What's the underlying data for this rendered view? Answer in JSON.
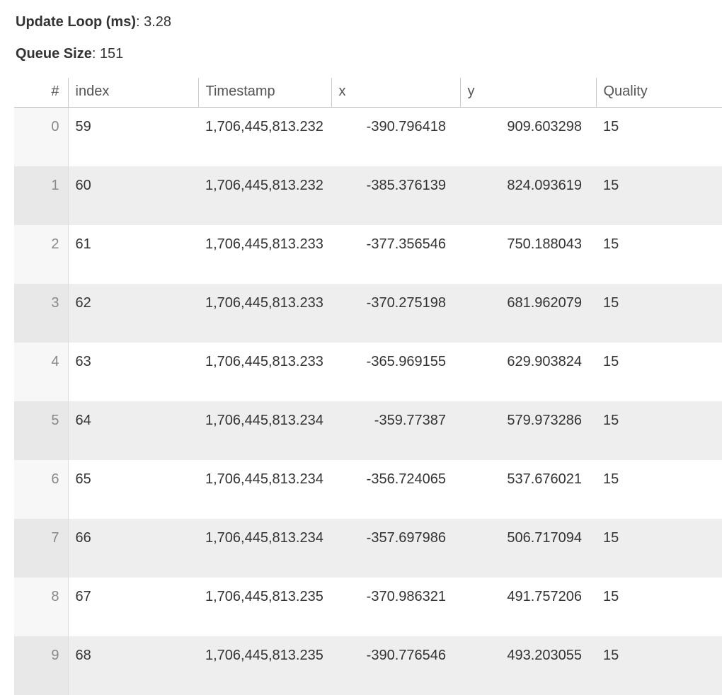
{
  "stats": {
    "update_loop_label": "Update Loop (ms)",
    "update_loop_value": "3.28",
    "queue_size_label": "Queue Size",
    "queue_size_value": "151"
  },
  "table": {
    "headers": {
      "rownum": "#",
      "index": "index",
      "timestamp": "Timestamp",
      "x": "x",
      "y": "y",
      "quality": "Quality"
    },
    "rows": [
      {
        "rownum": "0",
        "index": "59",
        "timestamp": "1,706,445,813.232",
        "x": "-390.796418",
        "y": "909.603298",
        "quality": "15"
      },
      {
        "rownum": "1",
        "index": "60",
        "timestamp": "1,706,445,813.232",
        "x": "-385.376139",
        "y": "824.093619",
        "quality": "15"
      },
      {
        "rownum": "2",
        "index": "61",
        "timestamp": "1,706,445,813.233",
        "x": "-377.356546",
        "y": "750.188043",
        "quality": "15"
      },
      {
        "rownum": "3",
        "index": "62",
        "timestamp": "1,706,445,813.233",
        "x": "-370.275198",
        "y": "681.962079",
        "quality": "15"
      },
      {
        "rownum": "4",
        "index": "63",
        "timestamp": "1,706,445,813.233",
        "x": "-365.969155",
        "y": "629.903824",
        "quality": "15"
      },
      {
        "rownum": "5",
        "index": "64",
        "timestamp": "1,706,445,813.234",
        "x": "-359.77387",
        "y": "579.973286",
        "quality": "15"
      },
      {
        "rownum": "6",
        "index": "65",
        "timestamp": "1,706,445,813.234",
        "x": "-356.724065",
        "y": "537.676021",
        "quality": "15"
      },
      {
        "rownum": "7",
        "index": "66",
        "timestamp": "1,706,445,813.234",
        "x": "-357.697986",
        "y": "506.717094",
        "quality": "15"
      },
      {
        "rownum": "8",
        "index": "67",
        "timestamp": "1,706,445,813.235",
        "x": "-370.986321",
        "y": "491.757206",
        "quality": "15"
      },
      {
        "rownum": "9",
        "index": "68",
        "timestamp": "1,706,445,813.235",
        "x": "-390.776546",
        "y": "493.203055",
        "quality": "15"
      }
    ]
  }
}
